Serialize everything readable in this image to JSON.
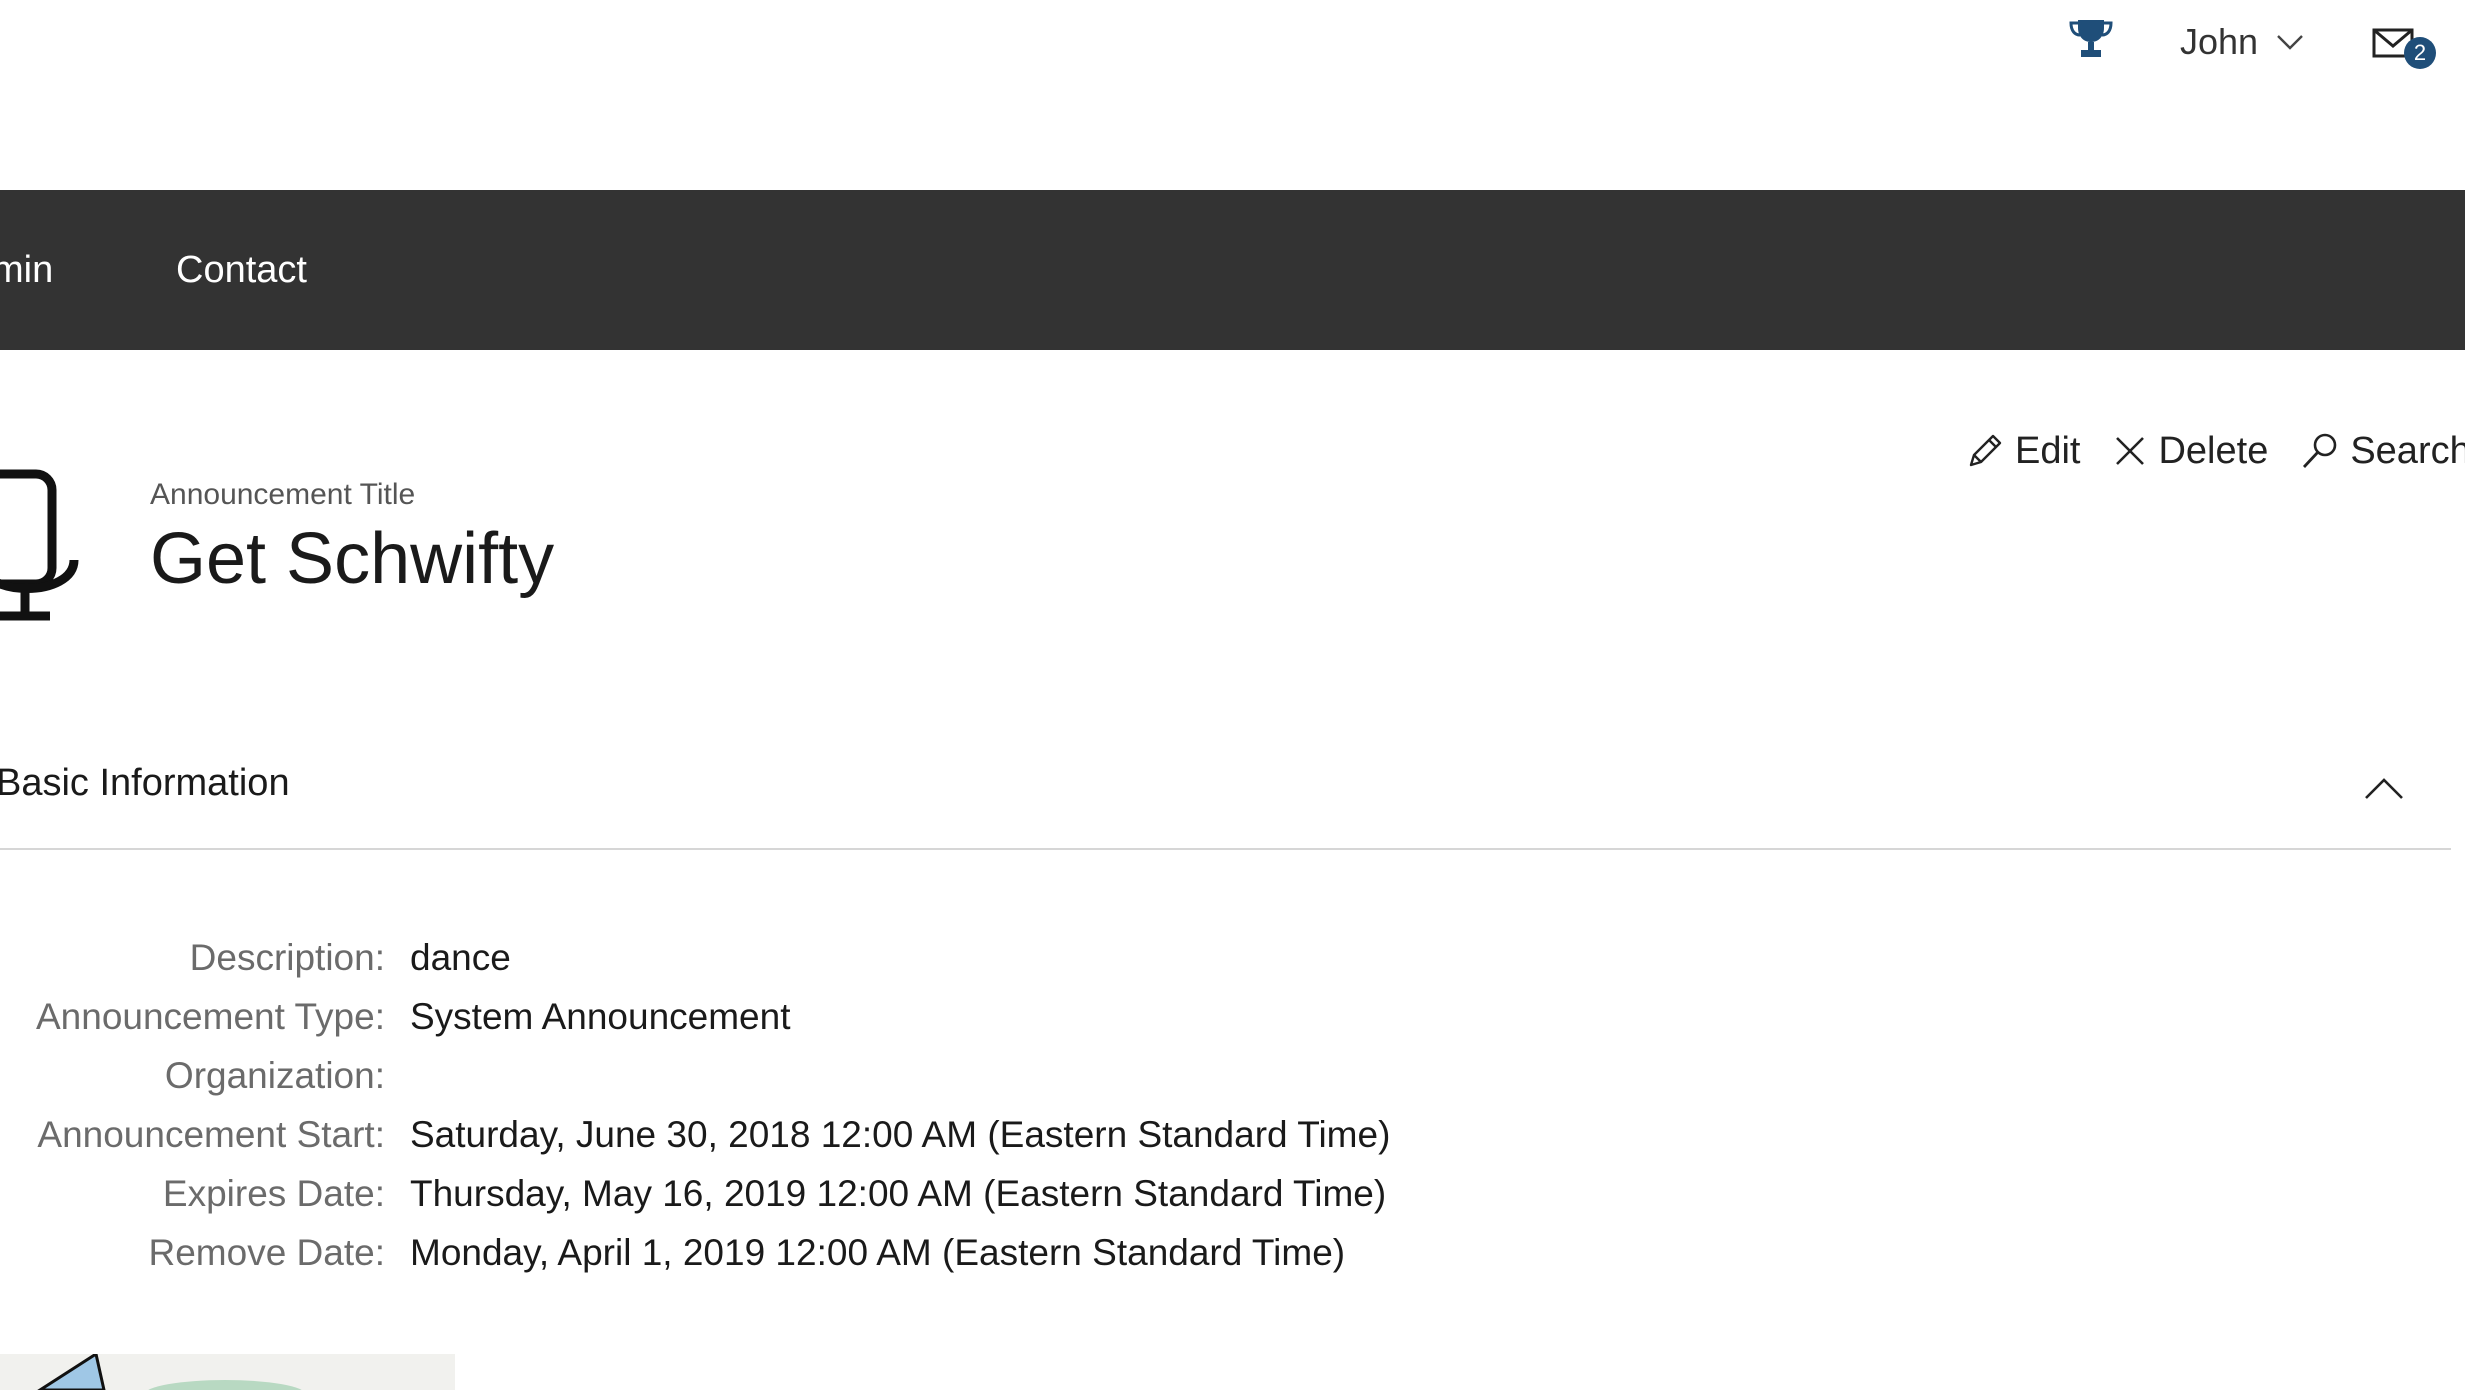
{
  "header": {
    "user_name": "John",
    "mail_badge": "2",
    "icons": [
      "trophy-icon",
      "chevron-down-icon",
      "mail-icon"
    ]
  },
  "nav": {
    "items": [
      {
        "label": "min"
      },
      {
        "label": "Contact"
      }
    ]
  },
  "actions": [
    {
      "label": "Edit",
      "icon": "pencil-icon"
    },
    {
      "label": "Delete",
      "icon": "close-icon"
    },
    {
      "label": "Search",
      "icon": "search-icon"
    }
  ],
  "record": {
    "icon": "microphone-icon",
    "title_label": "Announcement Title",
    "title_value": "Get Schwifty"
  },
  "section": {
    "title": "Basic Information",
    "fields": [
      {
        "label": "Description:",
        "value": "dance"
      },
      {
        "label": "Announcement Type:",
        "value": "System Announcement"
      },
      {
        "label": "Organization:",
        "value": ""
      },
      {
        "label": "Announcement Start:",
        "value": "Saturday, June 30, 2018 12:00 AM (Eastern Standard Time)"
      },
      {
        "label": "Expires Date:",
        "value": "Thursday, May 16, 2019 12:00 AM (Eastern Standard Time)"
      },
      {
        "label": "Remove Date:",
        "value": "Monday, April 1, 2019 12:00 AM (Eastern Standard Time)"
      }
    ]
  },
  "colors": {
    "navbar": "#333333",
    "trophy": "#1f4e79",
    "badge": "#1f4e79"
  }
}
